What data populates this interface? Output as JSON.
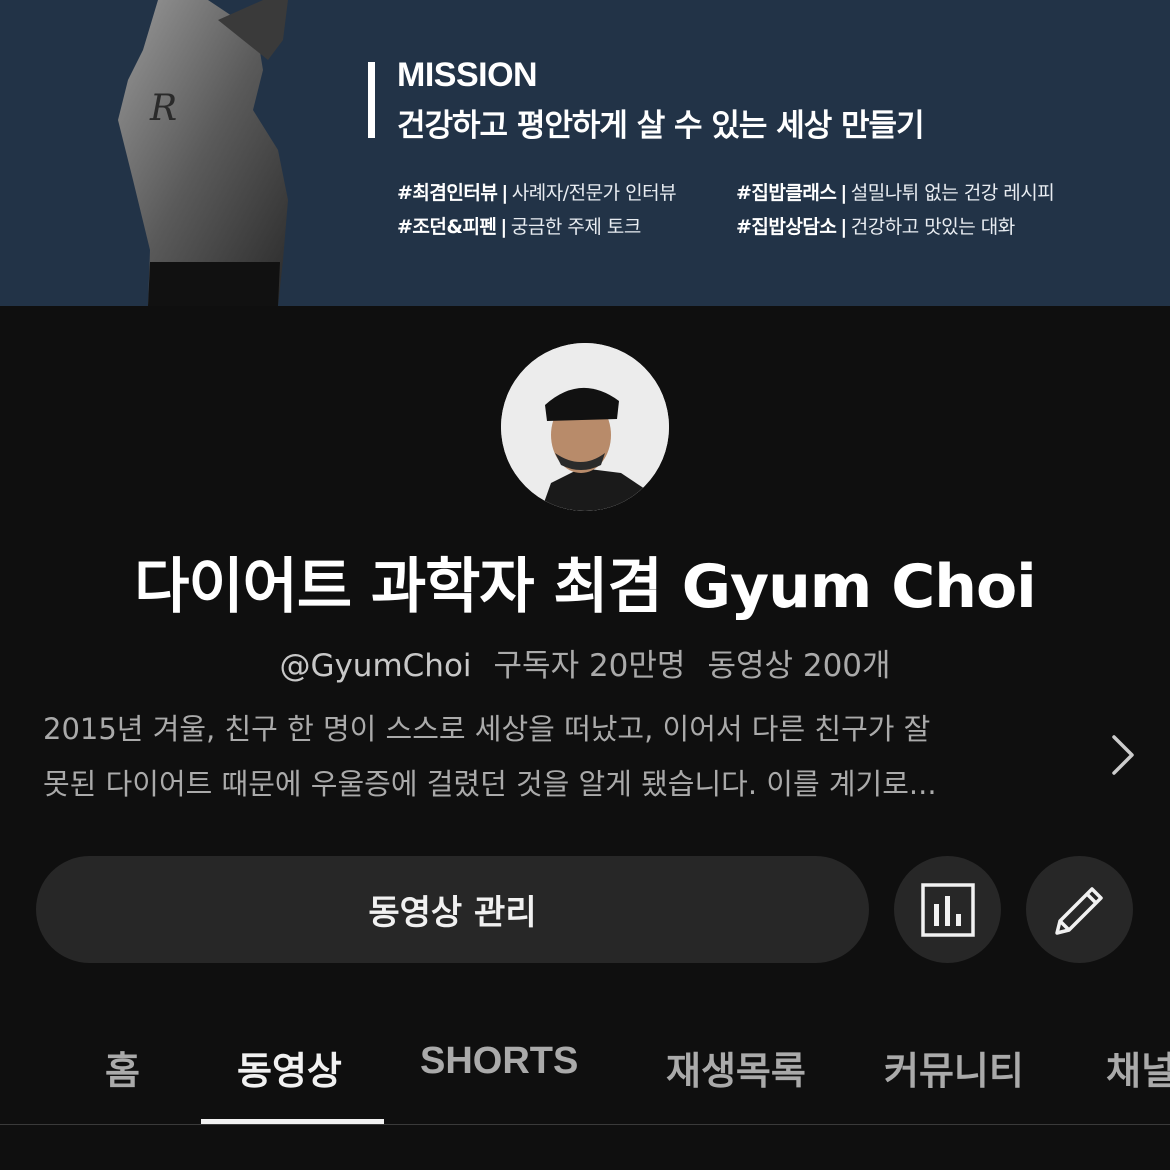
{
  "banner": {
    "mission_title": "MISSION",
    "mission_text": "건강하고 평안하게 살 수 있는 세상 만들기",
    "tags": [
      {
        "name": "#최겸인터뷰",
        "desc": "사례자/전문가 인터뷰"
      },
      {
        "name": "#집밥클래스",
        "desc": "설밀나튀 없는 건강 레시피"
      },
      {
        "name": "#조던&피펜",
        "desc": "궁금한 주제 토크"
      },
      {
        "name": "#집밥상담소",
        "desc": "건강하고 맛있는 대화"
      }
    ]
  },
  "channel": {
    "name": "다이어트 과학자 최겸 Gyum Choi",
    "handle": "@GyumChoi",
    "subscribers": "구독자 20만명",
    "videos": "동영상 200개",
    "description_lines": [
      "2015년 겨울, 친구 한 명이 스스로 세상을 떠났고, 이어서 다른 친구가 잘",
      "못된 다이어트 때문에 우울증에 걸렸던 것을 알게 됐습니다. 이를 계기로..."
    ]
  },
  "actions": {
    "manage_videos_label": "동영상 관리",
    "analytics_icon": "analytics-icon",
    "edit_icon": "pencil-icon"
  },
  "tabs": [
    "홈",
    "동영상",
    "SHORTS",
    "재생목록",
    "커뮤니티",
    "채널"
  ],
  "active_tab": "동영상",
  "colors": {
    "background": "#0f0f0f",
    "banner": "#223347",
    "button": "#272727",
    "text_primary": "#f1f1f1",
    "text_secondary": "#aaaaaa"
  }
}
